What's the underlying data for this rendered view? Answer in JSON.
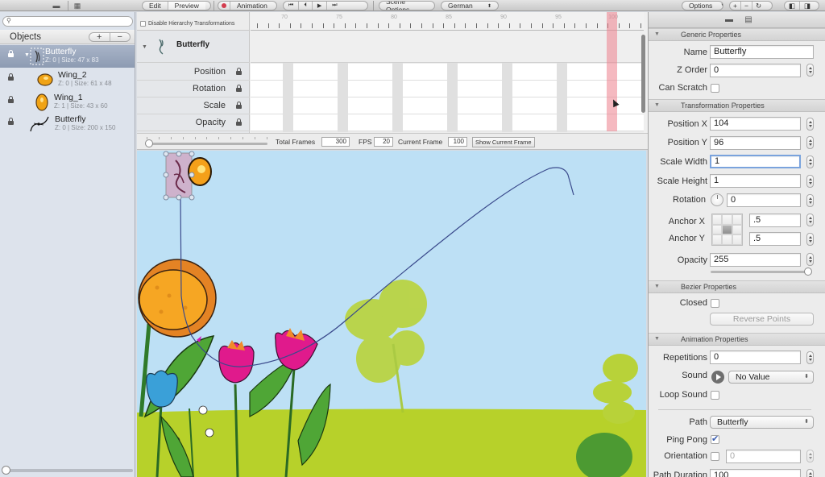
{
  "toolbar": {
    "left_icons": [
      "folder-icon",
      "layout-icon"
    ],
    "mode_tabs": [
      {
        "label": "Edit",
        "active": false
      },
      {
        "label": "Preview",
        "active": true
      }
    ],
    "animation_label": "Animation",
    "transport": [
      "skip-to-start-icon",
      "step-back-icon",
      "play-icon",
      "step-forward-icon"
    ],
    "scene_options_label": "Scene Options",
    "language_select": "German",
    "options_label": "Options",
    "zoom_controls": [
      "+",
      "−",
      "↻"
    ],
    "view_toggles": [
      "left-pane-icon",
      "right-pane-icon"
    ]
  },
  "objects_panel": {
    "search_placeholder": "",
    "title": "Objects",
    "add_label": "+",
    "remove_label": "−",
    "items": [
      {
        "name": "Butterfly",
        "meta": "Z: 0 | Size: 47 x 83",
        "selected": true,
        "kind": "sprite-group",
        "expanded": true
      },
      {
        "name": "Wing_2",
        "meta": "Z: 0 | Size: 61 x 48",
        "selected": false,
        "kind": "wing"
      },
      {
        "name": "Wing_1",
        "meta": "Z: 1 | Size: 43 x 60",
        "selected": false,
        "kind": "wing"
      },
      {
        "name": "Butterfly",
        "meta": "Z: 0 | Size: 200 x 150",
        "selected": false,
        "kind": "bezier-path"
      }
    ],
    "zoom_slider": 0
  },
  "timeline": {
    "disable_hierarchy_label": "Disable Hierarchy Transformations",
    "disable_hierarchy_checked": false,
    "ruler_labels": [
      "70",
      "75",
      "80",
      "85",
      "90",
      "95",
      "100"
    ],
    "object_name": "Butterfly",
    "properties": [
      "Position",
      "Rotation",
      "Scale",
      "Opacity"
    ],
    "playhead_frame": 100
  },
  "frames_bar": {
    "total_frames_label": "Total Frames",
    "total_frames": "300",
    "fps_label": "FPS",
    "fps": "20",
    "current_frame_label": "Current Frame",
    "current_frame": "100",
    "show_current_frame_label": "Show Current Frame"
  },
  "inspector": {
    "generic": {
      "title": "Generic Properties",
      "name_label": "Name",
      "name_value": "Butterfly",
      "z_order_label": "Z Order",
      "z_order_value": "0",
      "can_scratch_label": "Can Scratch",
      "can_scratch": false
    },
    "transformation": {
      "title": "Transformation Properties",
      "position_x_label": "Position X",
      "position_x": "104",
      "position_y_label": "Position Y",
      "position_y": "96",
      "scale_width_label": "Scale Width",
      "scale_width": "1",
      "scale_height_label": "Scale Height",
      "scale_height": "1",
      "rotation_label": "Rotation",
      "rotation": "0",
      "anchor_x_label": "Anchor X",
      "anchor_x": ".5",
      "anchor_y_label": "Anchor Y",
      "anchor_y": ".5",
      "opacity_label": "Opacity",
      "opacity": "255",
      "opacity_slider_fraction": 1.0
    },
    "bezier": {
      "title": "Bezier Properties",
      "closed_label": "Closed",
      "closed": false,
      "reverse_points_label": "Reverse Points"
    },
    "animation": {
      "title": "Animation Properties",
      "repetitions_label": "Repetitions",
      "repetitions": "0",
      "sound_label": "Sound",
      "sound_value": "No Value",
      "loop_sound_label": "Loop Sound",
      "loop_sound": false,
      "path_label": "Path",
      "path_value": "Butterfly",
      "ping_pong_label": "Ping Pong",
      "ping_pong": true,
      "orientation_label": "Orientation",
      "orientation_checked": false,
      "orientation_value": "0",
      "path_duration_label": "Path Duration",
      "path_duration": "100"
    }
  },
  "colors": {
    "sky": "#bde0f5",
    "grass": "#b7d12a",
    "playhead": "#ec808c",
    "selection": "#8d9bb2",
    "path_line": "#3a4a8c"
  }
}
